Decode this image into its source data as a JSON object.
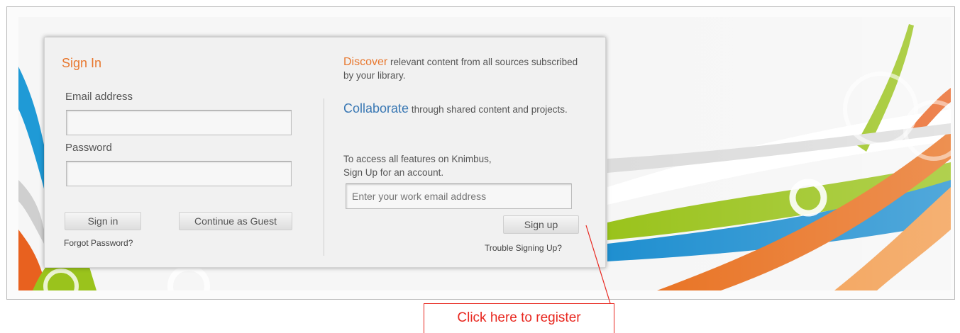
{
  "signin": {
    "title": "Sign In",
    "email_label": "Email address",
    "email_value": "",
    "password_label": "Password",
    "password_value": "",
    "signin_button": "Sign in",
    "guest_button": "Continue as Guest",
    "forgot_link": "Forgot Password?"
  },
  "signup": {
    "discover_highlight": "Discover",
    "discover_text": " relevant content from all sources subscribed by your library.",
    "collaborate_highlight": "Collaborate",
    "collaborate_text": " through shared content and projects.",
    "access_line1": "To access all features on Knimbus,",
    "access_line2": "Sign Up for an account.",
    "email_placeholder": "Enter your work email address",
    "signup_button": "Sign up",
    "trouble_link": "Trouble Signing Up?"
  },
  "annotation": {
    "callout_text": "Click here to register"
  },
  "colors": {
    "accent_orange": "#e8782f",
    "accent_blue": "#3a78b4",
    "annotation_red": "#e8271f"
  }
}
